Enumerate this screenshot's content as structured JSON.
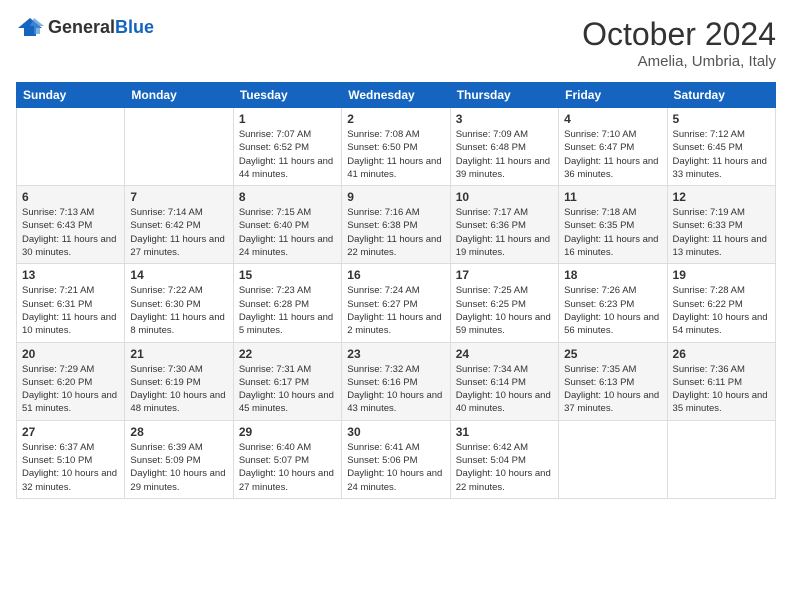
{
  "header": {
    "logo_general": "General",
    "logo_blue": "Blue",
    "month": "October 2024",
    "location": "Amelia, Umbria, Italy"
  },
  "weekdays": [
    "Sunday",
    "Monday",
    "Tuesday",
    "Wednesday",
    "Thursday",
    "Friday",
    "Saturday"
  ],
  "weeks": [
    [
      {
        "day": "",
        "info": ""
      },
      {
        "day": "",
        "info": ""
      },
      {
        "day": "1",
        "info": "Sunrise: 7:07 AM\nSunset: 6:52 PM\nDaylight: 11 hours and 44 minutes."
      },
      {
        "day": "2",
        "info": "Sunrise: 7:08 AM\nSunset: 6:50 PM\nDaylight: 11 hours and 41 minutes."
      },
      {
        "day": "3",
        "info": "Sunrise: 7:09 AM\nSunset: 6:48 PM\nDaylight: 11 hours and 39 minutes."
      },
      {
        "day": "4",
        "info": "Sunrise: 7:10 AM\nSunset: 6:47 PM\nDaylight: 11 hours and 36 minutes."
      },
      {
        "day": "5",
        "info": "Sunrise: 7:12 AM\nSunset: 6:45 PM\nDaylight: 11 hours and 33 minutes."
      }
    ],
    [
      {
        "day": "6",
        "info": "Sunrise: 7:13 AM\nSunset: 6:43 PM\nDaylight: 11 hours and 30 minutes."
      },
      {
        "day": "7",
        "info": "Sunrise: 7:14 AM\nSunset: 6:42 PM\nDaylight: 11 hours and 27 minutes."
      },
      {
        "day": "8",
        "info": "Sunrise: 7:15 AM\nSunset: 6:40 PM\nDaylight: 11 hours and 24 minutes."
      },
      {
        "day": "9",
        "info": "Sunrise: 7:16 AM\nSunset: 6:38 PM\nDaylight: 11 hours and 22 minutes."
      },
      {
        "day": "10",
        "info": "Sunrise: 7:17 AM\nSunset: 6:36 PM\nDaylight: 11 hours and 19 minutes."
      },
      {
        "day": "11",
        "info": "Sunrise: 7:18 AM\nSunset: 6:35 PM\nDaylight: 11 hours and 16 minutes."
      },
      {
        "day": "12",
        "info": "Sunrise: 7:19 AM\nSunset: 6:33 PM\nDaylight: 11 hours and 13 minutes."
      }
    ],
    [
      {
        "day": "13",
        "info": "Sunrise: 7:21 AM\nSunset: 6:31 PM\nDaylight: 11 hours and 10 minutes."
      },
      {
        "day": "14",
        "info": "Sunrise: 7:22 AM\nSunset: 6:30 PM\nDaylight: 11 hours and 8 minutes."
      },
      {
        "day": "15",
        "info": "Sunrise: 7:23 AM\nSunset: 6:28 PM\nDaylight: 11 hours and 5 minutes."
      },
      {
        "day": "16",
        "info": "Sunrise: 7:24 AM\nSunset: 6:27 PM\nDaylight: 11 hours and 2 minutes."
      },
      {
        "day": "17",
        "info": "Sunrise: 7:25 AM\nSunset: 6:25 PM\nDaylight: 10 hours and 59 minutes."
      },
      {
        "day": "18",
        "info": "Sunrise: 7:26 AM\nSunset: 6:23 PM\nDaylight: 10 hours and 56 minutes."
      },
      {
        "day": "19",
        "info": "Sunrise: 7:28 AM\nSunset: 6:22 PM\nDaylight: 10 hours and 54 minutes."
      }
    ],
    [
      {
        "day": "20",
        "info": "Sunrise: 7:29 AM\nSunset: 6:20 PM\nDaylight: 10 hours and 51 minutes."
      },
      {
        "day": "21",
        "info": "Sunrise: 7:30 AM\nSunset: 6:19 PM\nDaylight: 10 hours and 48 minutes."
      },
      {
        "day": "22",
        "info": "Sunrise: 7:31 AM\nSunset: 6:17 PM\nDaylight: 10 hours and 45 minutes."
      },
      {
        "day": "23",
        "info": "Sunrise: 7:32 AM\nSunset: 6:16 PM\nDaylight: 10 hours and 43 minutes."
      },
      {
        "day": "24",
        "info": "Sunrise: 7:34 AM\nSunset: 6:14 PM\nDaylight: 10 hours and 40 minutes."
      },
      {
        "day": "25",
        "info": "Sunrise: 7:35 AM\nSunset: 6:13 PM\nDaylight: 10 hours and 37 minutes."
      },
      {
        "day": "26",
        "info": "Sunrise: 7:36 AM\nSunset: 6:11 PM\nDaylight: 10 hours and 35 minutes."
      }
    ],
    [
      {
        "day": "27",
        "info": "Sunrise: 6:37 AM\nSunset: 5:10 PM\nDaylight: 10 hours and 32 minutes."
      },
      {
        "day": "28",
        "info": "Sunrise: 6:39 AM\nSunset: 5:09 PM\nDaylight: 10 hours and 29 minutes."
      },
      {
        "day": "29",
        "info": "Sunrise: 6:40 AM\nSunset: 5:07 PM\nDaylight: 10 hours and 27 minutes."
      },
      {
        "day": "30",
        "info": "Sunrise: 6:41 AM\nSunset: 5:06 PM\nDaylight: 10 hours and 24 minutes."
      },
      {
        "day": "31",
        "info": "Sunrise: 6:42 AM\nSunset: 5:04 PM\nDaylight: 10 hours and 22 minutes."
      },
      {
        "day": "",
        "info": ""
      },
      {
        "day": "",
        "info": ""
      }
    ]
  ]
}
